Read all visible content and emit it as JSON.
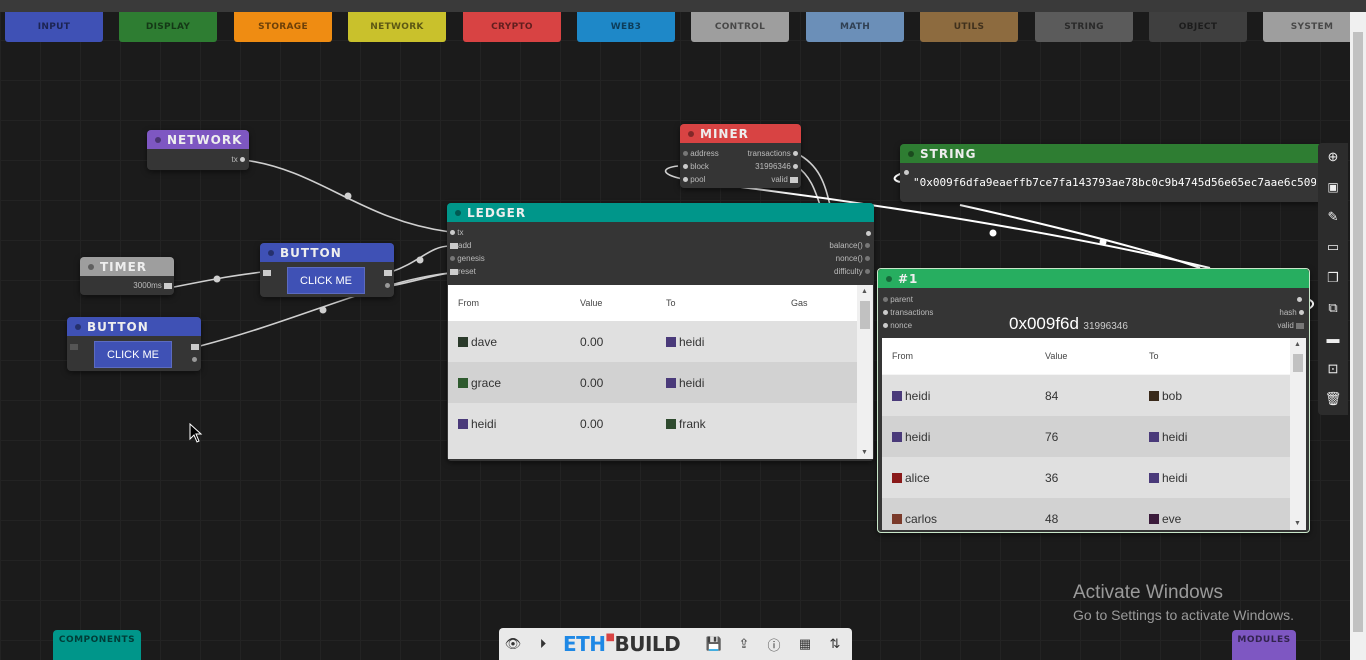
{
  "palette": [
    {
      "label": "INPUT",
      "color": "#3f51b5"
    },
    {
      "label": "DISPLAY",
      "color": "#2e7d32"
    },
    {
      "label": "STORAGE",
      "color": "#ef8c12"
    },
    {
      "label": "NETWORK",
      "color": "#c9c12c"
    },
    {
      "label": "CRYPTO",
      "color": "#d84343"
    },
    {
      "label": "WEB3",
      "color": "#1e88c8"
    },
    {
      "label": "CONTROL",
      "color": "#9e9e9e"
    },
    {
      "label": "MATH",
      "color": "#6b8fb8"
    },
    {
      "label": "UTILS",
      "color": "#8d6b3f"
    },
    {
      "label": "STRING",
      "color": "#5b5b5b"
    },
    {
      "label": "OBJECT",
      "color": "#3f3f3f"
    },
    {
      "label": "SYSTEM",
      "color": "#9e9e9e"
    }
  ],
  "nodes": {
    "network": {
      "title": "NETWORK",
      "out_tx": "tx",
      "color": "#7e57c2"
    },
    "timer": {
      "title": "TIMER",
      "interval": "3000ms",
      "color": "#9e9e9e"
    },
    "button1": {
      "title": "BUTTON",
      "label": "CLICK ME",
      "color": "#3f51b5"
    },
    "button2": {
      "title": "BUTTON",
      "label": "CLICK ME",
      "color": "#3f51b5"
    },
    "miner": {
      "title": "MINER",
      "color": "#d84343",
      "inputs": [
        "address",
        "block",
        "pool"
      ],
      "outputs": [
        "transactions",
        "31996346",
        "valid"
      ]
    },
    "string": {
      "title": "STRING",
      "color": "#2e7d32",
      "value": "\"0x009f6dfa9eaeffb7ce7fa143793ae78bc0c9b4745d56e65ec7aae6c509"
    },
    "ledger": {
      "title": "LEDGER",
      "color": "#00968a",
      "inputs": [
        "tx",
        "add",
        "genesis",
        "reset"
      ],
      "outputs": [
        "balance()",
        "nonce()",
        "difficulty"
      ],
      "columns": [
        "From",
        "Value",
        "To",
        "Gas"
      ],
      "rows": [
        {
          "from": "dave",
          "value": "0.00",
          "to": "heidi"
        },
        {
          "from": "grace",
          "value": "0.00",
          "to": "heidi"
        },
        {
          "from": "heidi",
          "value": "0.00",
          "to": "frank"
        }
      ]
    },
    "block": {
      "title": "#1",
      "color": "#27ae60",
      "inputs": [
        "parent",
        "transactions",
        "nonce"
      ],
      "outputs": [
        "hash",
        "valid"
      ],
      "hash": "0x009f6d",
      "nonce": "31996346",
      "columns": [
        "From",
        "Value",
        "To"
      ],
      "rows": [
        {
          "from": "heidi",
          "value": "84",
          "to": "bob"
        },
        {
          "from": "heidi",
          "value": "76",
          "to": "heidi"
        },
        {
          "from": "alice",
          "value": "36",
          "to": "heidi"
        },
        {
          "from": "carlos",
          "value": "48",
          "to": "eve"
        }
      ]
    }
  },
  "bottom": {
    "components_label": "COMPONENTS",
    "modules_label": "MODULES",
    "logo_eth": "ETH",
    "logo_build": "BUILD"
  },
  "watermark": {
    "title": "Activate Windows",
    "subtitle": "Go to Settings to activate Windows."
  }
}
